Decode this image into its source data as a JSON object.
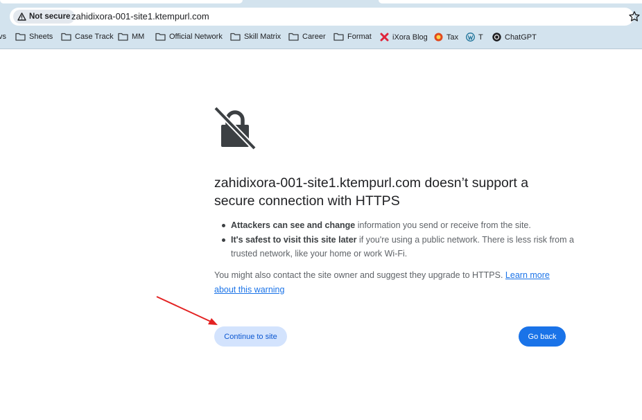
{
  "browser": {
    "security_label": "Not secure",
    "url": "zahidixora-001-site1.ktempurl.com",
    "bookmarks": [
      {
        "label": "Sheets",
        "icon": "folder-icon"
      },
      {
        "label": "Case Track",
        "icon": "folder-icon"
      },
      {
        "label": "MM",
        "icon": "folder-icon"
      },
      {
        "label": "Official Network",
        "icon": "folder-icon"
      },
      {
        "label": "Skill Matrix",
        "icon": "folder-icon"
      },
      {
        "label": "Career",
        "icon": "folder-icon"
      },
      {
        "label": "Format",
        "icon": "folder-icon"
      },
      {
        "label": "iXora Blog",
        "icon": "ixora-icon"
      },
      {
        "label": "Tax",
        "icon": "tax-icon"
      },
      {
        "label": "T",
        "icon": "wordpress-icon"
      },
      {
        "label": "ChatGPT",
        "icon": "chatgpt-icon"
      }
    ],
    "truncated_left_label": "vs"
  },
  "interstitial": {
    "icon": "broken-lock-icon",
    "heading": "zahidixora-001-site1.ktempurl.com doesn’t support a secure connection with HTTPS",
    "bullets": [
      {
        "bold": "Attackers can see and change",
        "text": " information you send or receive from the site."
      },
      {
        "bold": "It's safest to visit this site later",
        "text": " if you're using a public network. There is less risk from a trusted network, like your home or work Wi-Fi."
      }
    ],
    "paragraph_text": "You might also contact the site owner and suggest they upgrade to HTTPS. ",
    "learn_more_link": "Learn more about this warning",
    "continue_button": "Continue to site",
    "back_button": "Go back"
  },
  "colors": {
    "chrome_bg": "#d3e3ee",
    "primary_button": "#1a73e8",
    "secondary_button": "#d3e3fd",
    "link": "#1a73e8",
    "annotation_arrow": "#e32222"
  }
}
